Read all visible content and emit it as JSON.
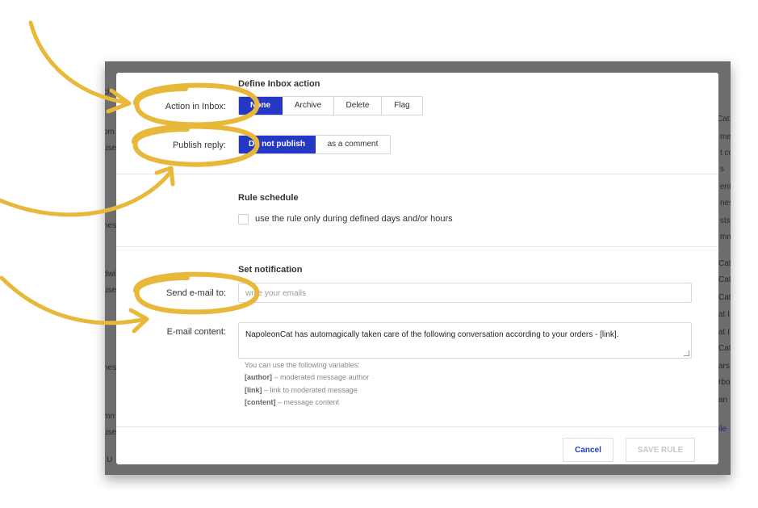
{
  "background": {
    "left_snippets": [
      "chi",
      "om",
      "use",
      "ness",
      "dwi",
      "use",
      "ness",
      "mn",
      "use",
      "U"
    ],
    "right_snippets": [
      "Cat.",
      "me",
      "t co",
      "s",
      "ent",
      "ness",
      "sts",
      "mm",
      "Cat",
      "Cat",
      "Cat.",
      "at I",
      "at I",
      "Cat",
      "ars",
      "rbo",
      "an",
      "ile"
    ]
  },
  "inbox_action": {
    "section_title": "Define Inbox action",
    "action_label": "Action in Inbox:",
    "action_options": [
      "None",
      "Archive",
      "Delete",
      "Flag"
    ],
    "action_selected": "None",
    "publish_label": "Publish reply:",
    "publish_options": [
      "Do not publish",
      "as a comment"
    ],
    "publish_selected": "Do not publish"
  },
  "schedule": {
    "section_title": "Rule schedule",
    "checkbox_label": "use the rule only during defined days and/or hours",
    "checked": false
  },
  "notification": {
    "section_title": "Set notification",
    "email_label": "Send e-mail to:",
    "email_placeholder": "write your emails",
    "content_label": "E-mail content:",
    "content_value": "NapoleonCat has automagically taken care of the following conversation according to your orders - [link].",
    "help_intro": "You can use the following variables:",
    "variables": [
      {
        "name": "[author]",
        "desc": "– moderated message author"
      },
      {
        "name": "[link]",
        "desc": "– link to moderated message"
      },
      {
        "name": "[content]",
        "desc": "– message content"
      }
    ]
  },
  "footer": {
    "cancel_label": "Cancel",
    "save_label": "SAVE RULE"
  },
  "colors": {
    "accent": "#2538c4",
    "annotation": "#e8b83a",
    "backdrop": "#6d6d6d"
  }
}
